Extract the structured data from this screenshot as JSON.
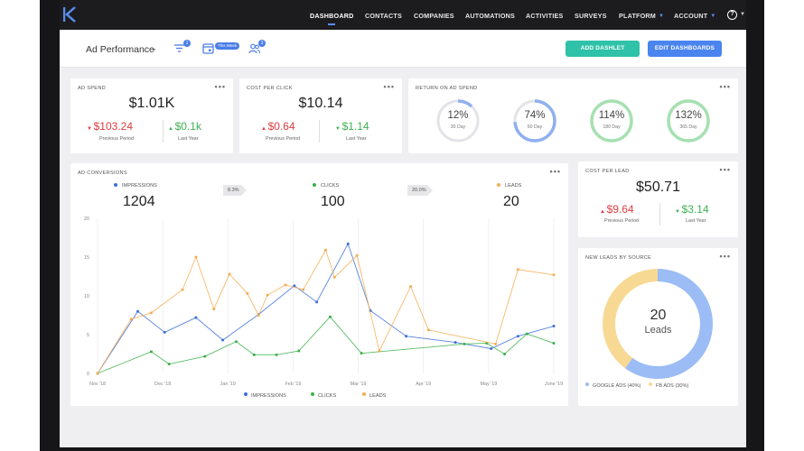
{
  "nav": {
    "items": [
      "DASHBOARD",
      "CONTACTS",
      "COMPANIES",
      "AUTOMATIONS",
      "ACTIVITIES",
      "SURVEYS",
      "PLATFORM",
      "ACCOUNT"
    ],
    "active": "DASHBOARD",
    "help_label": "?"
  },
  "toolbar": {
    "title": "Ad Performance",
    "filter_badge": "1",
    "date_pill": "This Week",
    "users_badge": "3",
    "add_label": "ADD DASHLET",
    "edit_label": "EDIT  DASHBOARDS"
  },
  "ad_spend": {
    "title": "AD SPEND",
    "value": "$1.01K",
    "prev_value": "$103.24",
    "prev_label": "Previous Period",
    "year_value": "$0.1k",
    "year_label": "Last Year"
  },
  "cpc": {
    "title": "COST PER CLICK",
    "value": "$10.14",
    "prev_value": "$0.64",
    "prev_label": "Previous Period",
    "year_value": "$1.14",
    "year_label": "Last Year"
  },
  "roas": {
    "title": "RETURN ON AD SPEND",
    "rings": [
      {
        "value": "12%",
        "label": "30 Day",
        "pct": 0.12,
        "color": "#8fb0f0",
        "track": "#e4e4e8"
      },
      {
        "value": "74%",
        "label": "60 Day",
        "pct": 0.74,
        "color": "#8fb0f0",
        "track": "#e4e4e8"
      },
      {
        "value": "114%",
        "label": "180 Day",
        "pct": 1.0,
        "color": "#a7e0b2",
        "track": "#a7e0b2"
      },
      {
        "value": "132%",
        "label": "365 Day",
        "pct": 1.0,
        "color": "#a7e0b2",
        "track": "#a7e0b2"
      }
    ]
  },
  "conversions": {
    "title": "AD CONVERSIONS",
    "impressions_label": "IMPRESSIONS",
    "impressions_value": "1204",
    "rate1": "8.3%",
    "clicks_label": "CLICKS",
    "clicks_value": "100",
    "rate2": "20.0%",
    "leads_label": "LEADS",
    "leads_value": "20"
  },
  "cpl": {
    "title": "COST PER LEAD",
    "value": "$50.71",
    "prev_value": "$9.64",
    "prev_label": "Previous Period",
    "year_value": "$3.14",
    "year_label": "Last Year"
  },
  "leads_source": {
    "title": "NEW LEADS BY SOURCE",
    "center_value": "20",
    "center_label": "Leads",
    "legend": [
      "GOOGLE ADS (40%)",
      "FB ADS (30%)"
    ]
  },
  "chart_data": {
    "type": "line",
    "x_ticks": [
      "Nov '18",
      "Dec '18",
      "Jan '19",
      "Feb '19",
      "Mar '19",
      "Apr '19",
      "May '19",
      "June '19"
    ],
    "ylim": [
      0,
      20
    ],
    "y_ticks": [
      "0",
      "5",
      "10",
      "15",
      "20"
    ],
    "series": [
      {
        "name": "IMPRESSIONS",
        "color": "#3b6fd8",
        "points": [
          [
            0,
            0
          ],
          [
            0.9,
            8
          ],
          [
            1.5,
            5.3
          ],
          [
            2.2,
            7.2
          ],
          [
            2.8,
            4.3
          ],
          [
            3.6,
            7.6
          ],
          [
            4.4,
            11.3
          ],
          [
            4.9,
            9.2
          ],
          [
            5.6,
            16.7
          ],
          [
            6.1,
            8.1
          ],
          [
            6.9,
            4.8
          ],
          [
            8.0,
            4.0
          ],
          [
            8.8,
            3.2
          ],
          [
            9.4,
            4.8
          ],
          [
            10.2,
            6.1
          ]
        ]
      },
      {
        "name": "CLICKS",
        "color": "#3bb04a",
        "points": [
          [
            0,
            0
          ],
          [
            1.2,
            2.8
          ],
          [
            1.6,
            1.2
          ],
          [
            2.4,
            2.2
          ],
          [
            3.1,
            4.1
          ],
          [
            3.5,
            2.4
          ],
          [
            4.0,
            2.4
          ],
          [
            4.5,
            2.9
          ],
          [
            5.2,
            7.3
          ],
          [
            5.9,
            2.6
          ],
          [
            8.2,
            3.8
          ],
          [
            8.7,
            3.9
          ],
          [
            9.1,
            2.5
          ],
          [
            9.6,
            5.1
          ],
          [
            10.2,
            3.9
          ]
        ]
      },
      {
        "name": "LEADS",
        "color": "#f4ad52",
        "points": [
          [
            0,
            0
          ],
          [
            0.75,
            7
          ],
          [
            1.2,
            7.8
          ],
          [
            1.9,
            10.8
          ],
          [
            2.2,
            15
          ],
          [
            2.6,
            8.3
          ],
          [
            2.95,
            12.8
          ],
          [
            3.35,
            10.3
          ],
          [
            3.6,
            7.5
          ],
          [
            3.8,
            10.1
          ],
          [
            4.2,
            11.4
          ],
          [
            4.6,
            10.8
          ],
          [
            5.1,
            15.9
          ],
          [
            5.3,
            12.4
          ],
          [
            5.8,
            15.2
          ],
          [
            6.3,
            2.9
          ],
          [
            7.0,
            11.2
          ],
          [
            7.4,
            5.6
          ],
          [
            8.9,
            3.8
          ],
          [
            9.4,
            13.4
          ],
          [
            10.2,
            12.7
          ]
        ]
      }
    ],
    "x_max": 10.2,
    "legend_position": "bottom",
    "grid": "vertical"
  },
  "leads_pie": {
    "type": "pie",
    "slices": [
      {
        "name": "GOOGLE ADS",
        "percent": 60,
        "color": "#9bbcf5"
      },
      {
        "name": "FB ADS",
        "percent": 40,
        "color": "#f7d994"
      }
    ]
  }
}
